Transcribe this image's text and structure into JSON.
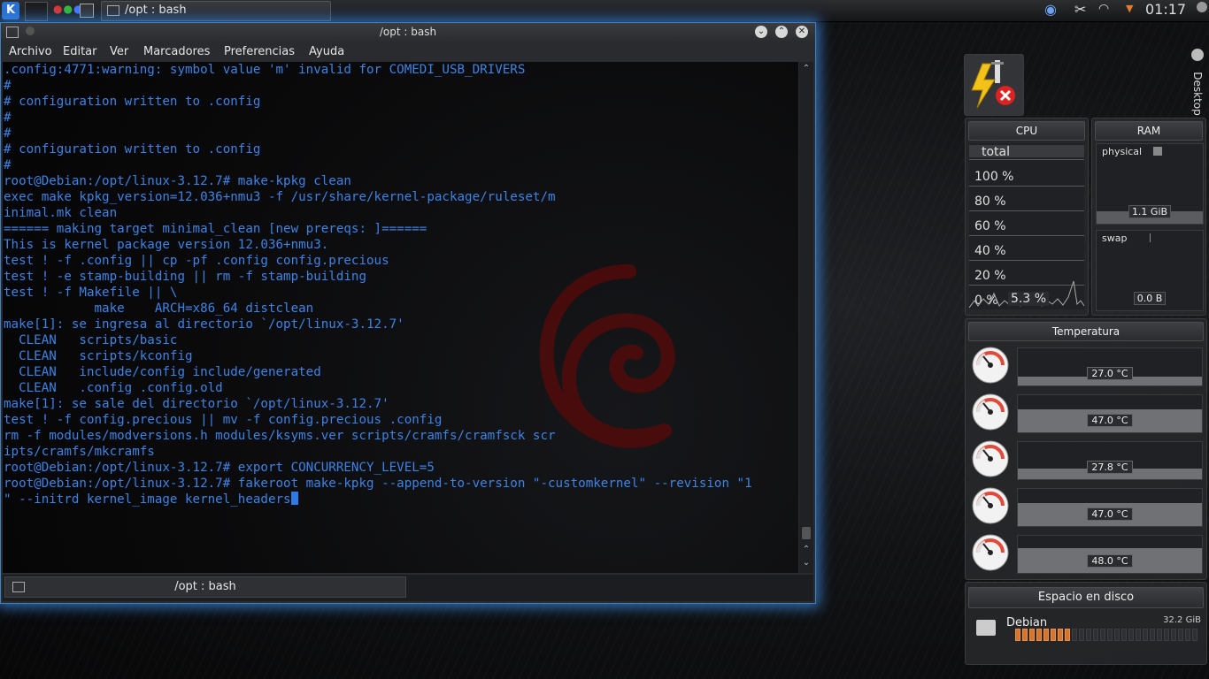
{
  "panel": {
    "kmenu_label": "K",
    "task_title": "/opt : bash",
    "clock": "01:17"
  },
  "window": {
    "title": "/opt : bash",
    "menu": [
      "Archivo",
      "Editar",
      "Ver",
      "Marcadores",
      "Preferencias",
      "Ayuda"
    ],
    "terminal_lines": [
      ".config:4771:warning: symbol value 'm' invalid for COMEDI_USB_DRIVERS",
      "#",
      "# configuration written to .config",
      "#",
      "#",
      "# configuration written to .config",
      "#",
      "root@Debian:/opt/linux-3.12.7# make-kpkg clean",
      "exec make kpkg_version=12.036+nmu3 -f /usr/share/kernel-package/ruleset/m",
      "inimal.mk clean",
      "====== making target minimal_clean [new prereqs: ]======",
      "This is kernel package version 12.036+nmu3.",
      "test ! -f .config || cp -pf .config config.precious",
      "test ! -e stamp-building || rm -f stamp-building",
      "test ! -f Makefile || \\",
      "            make    ARCH=x86_64 distclean",
      "make[1]: se ingresa al directorio `/opt/linux-3.12.7'",
      "  CLEAN   scripts/basic",
      "  CLEAN   scripts/kconfig",
      "  CLEAN   include/config include/generated",
      "  CLEAN   .config .config.old",
      "make[1]: se sale del directorio `/opt/linux-3.12.7'",
      "test ! -f config.precious || mv -f config.precious .config",
      "rm -f modules/modversions.h modules/ksyms.ver scripts/cramfs/cramfsck scr",
      "ipts/cramfs/mkcramfs",
      "root@Debian:/opt/linux-3.12.7# export CONCURRENCY_LEVEL=5",
      "root@Debian:/opt/linux-3.12.7# fakeroot make-kpkg --append-to-version \"-customkernel\" --revision \"1",
      "\" --initrd kernel_image kernel_headers"
    ],
    "tab_label": "/opt : bash"
  },
  "desktop_tab_label": "Desktop",
  "cpu": {
    "title": "CPU",
    "total_label": "total",
    "scale": [
      "100 %",
      "80 %",
      "60 %",
      "40 %",
      "20 %",
      "0 %"
    ],
    "current": "5.3 %",
    "usage_percent": 5.3
  },
  "ram": {
    "title": "RAM",
    "physical_label": "physical",
    "physical_value": "1.1 GiB",
    "swap_label": "swap",
    "swap_value": "0.0 B"
  },
  "temperature": {
    "title": "Temperatura",
    "sensors": [
      "27.0 °C",
      "47.0 °C",
      "27.8 °C",
      "47.0 °C",
      "48.0 °C"
    ]
  },
  "disk": {
    "title": "Espacio en disco",
    "name": "Debian",
    "size": "32.2 GiB",
    "used_fraction": 0.3
  },
  "colors": {
    "terminal_text": "#3d83e6",
    "window_glow": "#3c8ce6",
    "disk_fill": "#d8742a"
  }
}
